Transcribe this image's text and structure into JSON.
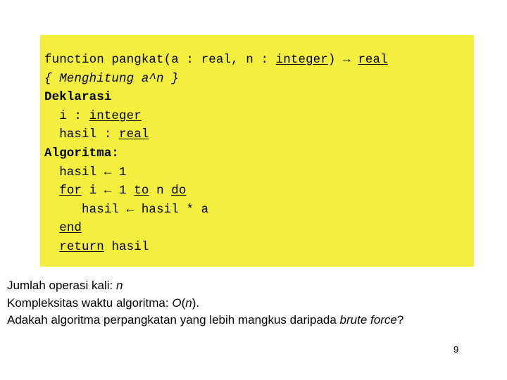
{
  "slide": {
    "page_number": "9",
    "background_color": "#ffffff"
  },
  "code_panel": {
    "background_color": "#f4ef3f",
    "language": "pseudocode",
    "lines": [
      {
        "id": "line-signature",
        "segments": [
          {
            "text": "function pangkat(a : real, n : ",
            "style": "plain"
          },
          {
            "text": "integer",
            "style": "underline"
          },
          {
            "text": ") ",
            "style": "plain"
          },
          {
            "text": "→",
            "style": "plain"
          },
          {
            "text": " ",
            "style": "plain"
          },
          {
            "text": "real",
            "style": "underline"
          }
        ]
      },
      {
        "id": "line-comment",
        "segments": [
          {
            "text": "{ Menghitung a^n }",
            "style": "italic"
          }
        ]
      },
      {
        "id": "line-deklarasi",
        "segments": [
          {
            "text": "Deklarasi",
            "style": "bold"
          }
        ]
      },
      {
        "id": "line-decl-i",
        "segments": [
          {
            "text": "  i : ",
            "style": "plain"
          },
          {
            "text": "integer",
            "style": "underline"
          }
        ]
      },
      {
        "id": "line-decl-hasil",
        "segments": [
          {
            "text": "  hasil : ",
            "style": "plain"
          },
          {
            "text": "real",
            "style": "underline"
          }
        ]
      },
      {
        "id": "line-algoritma",
        "segments": [
          {
            "text": "Algoritma:",
            "style": "bold"
          }
        ]
      },
      {
        "id": "line-init-hasil",
        "segments": [
          {
            "text": "  hasil ← 1",
            "style": "plain"
          }
        ]
      },
      {
        "id": "line-for",
        "segments": [
          {
            "text": "  ",
            "style": "plain"
          },
          {
            "text": "for",
            "style": "underline"
          },
          {
            "text": " i ← 1 ",
            "style": "plain"
          },
          {
            "text": "to",
            "style": "underline"
          },
          {
            "text": " n ",
            "style": "plain"
          },
          {
            "text": "do",
            "style": "underline"
          }
        ]
      },
      {
        "id": "line-loop-body",
        "segments": [
          {
            "text": "     hasil ← hasil * a",
            "style": "plain"
          }
        ]
      },
      {
        "id": "line-end",
        "segments": [
          {
            "text": "  ",
            "style": "plain"
          },
          {
            "text": "end",
            "style": "underline"
          }
        ]
      },
      {
        "id": "line-return",
        "segments": [
          {
            "text": "  ",
            "style": "plain"
          },
          {
            "text": "return",
            "style": "underline"
          },
          {
            "text": " hasil",
            "style": "plain"
          }
        ]
      }
    ]
  },
  "notes": {
    "lines": [
      {
        "id": "note-jumlah-operasi",
        "segments": [
          {
            "text": "Jumlah operasi kali: ",
            "style": "plain"
          },
          {
            "text": "n",
            "style": "italic"
          }
        ]
      },
      {
        "id": "note-kompleksitas",
        "segments": [
          {
            "text": "Kompleksitas waktu algoritma: ",
            "style": "plain"
          },
          {
            "text": "O",
            "style": "italic"
          },
          {
            "text": "(",
            "style": "plain"
          },
          {
            "text": "n",
            "style": "italic"
          },
          {
            "text": ").",
            "style": "plain"
          }
        ]
      },
      {
        "id": "note-pertanyaan",
        "segments": [
          {
            "text": "Adakah algoritma perpangkatan yang lebih mangkus daripada ",
            "style": "plain"
          },
          {
            "text": "brute force",
            "style": "italic"
          },
          {
            "text": "?",
            "style": "plain"
          }
        ]
      }
    ]
  }
}
